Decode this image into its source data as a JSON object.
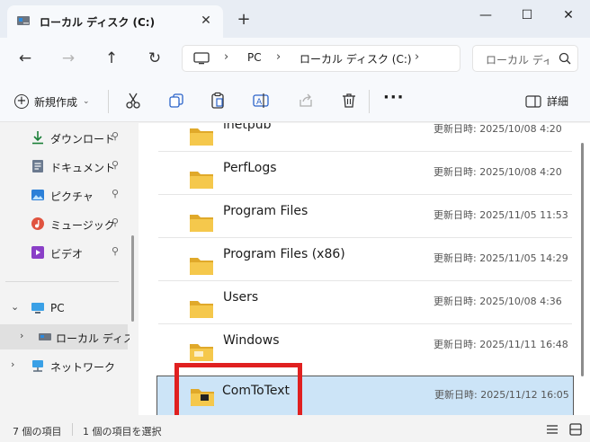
{
  "window": {
    "tab_title": "ローカル ディスク (C:)",
    "tab_close": "✕",
    "new_tab": "+",
    "minimize": "—",
    "maximize": "☐",
    "close": "✕"
  },
  "nav": {
    "back": "←",
    "forward": "→",
    "up": "↑",
    "refresh": "↻",
    "breadcrumb": [
      "PC",
      "ローカル ディスク (C:)"
    ],
    "sep": "›",
    "search_placeholder": "ローカル ディスク (C:) の検索"
  },
  "toolbar": {
    "new_label": "新規作成",
    "more_label": "···",
    "details_label": "詳細"
  },
  "sidebar": {
    "quick_access": [
      {
        "label": "ダウンロード",
        "icon": "download-icon",
        "color": "#1a7f37"
      },
      {
        "label": "ドキュメント",
        "icon": "document-icon",
        "color": "#6b7a8f"
      },
      {
        "label": "ピクチャ",
        "icon": "pictures-icon",
        "color": "#2b7fd8"
      },
      {
        "label": "ミュージック",
        "icon": "music-icon",
        "color": "#e0533f"
      },
      {
        "label": "ビデオ",
        "icon": "video-icon",
        "color": "#8a3fc7"
      }
    ],
    "pin": "📌",
    "tree": [
      {
        "label": "PC",
        "icon": "pc-icon"
      },
      {
        "label": "ローカル ディスク",
        "icon": "drive-icon"
      },
      {
        "label": "ネットワーク",
        "icon": "network-icon"
      }
    ]
  },
  "files": [
    {
      "name": "inetpub",
      "date": "更新日時: 2025/10/08 4:20"
    },
    {
      "name": "PerfLogs",
      "date": "更新日時: 2025/10/08 4:20"
    },
    {
      "name": "Program Files",
      "date": "更新日時: 2025/11/05 11:53"
    },
    {
      "name": "Program Files (x86)",
      "date": "更新日時: 2025/11/05 14:29"
    },
    {
      "name": "Users",
      "date": "更新日時: 2025/10/08 4:36"
    },
    {
      "name": "Windows",
      "date": "更新日時: 2025/11/11 16:48"
    },
    {
      "name": "ComToText",
      "date": "更新日時: 2025/11/12 16:05"
    }
  ],
  "status": {
    "item_count": "7 個の項目",
    "selected_count": "1 個の項目を選択"
  },
  "colors": {
    "folder": "#f5c84c",
    "folder_dark": "#e0a92a",
    "selection": "#cce4f7",
    "highlight": "#e02020"
  }
}
